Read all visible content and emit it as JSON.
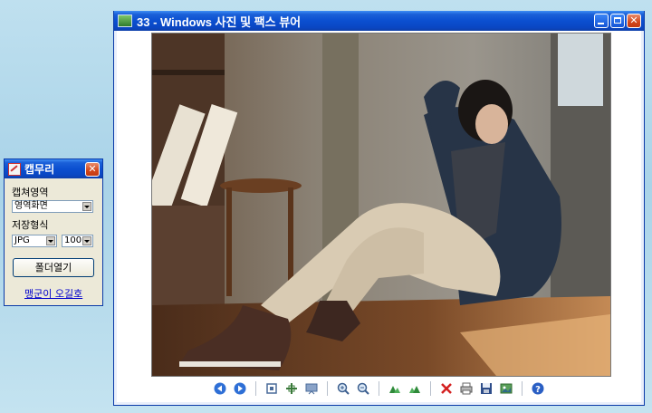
{
  "viewer": {
    "title": "33 - Windows 사진 및 팩스 뷰어",
    "image_description_name": "photo"
  },
  "capture": {
    "title": "캡무리",
    "area_label": "캡쳐영역",
    "area_value": "영역화면",
    "format_label": "저장형식",
    "format_value": "JPG",
    "quality_value": "100",
    "open_folder_button": "폴더열기",
    "link_text": "맹군이 오길호"
  },
  "toolbar": {
    "icons": [
      "prev-icon",
      "next-icon",
      "best-fit-icon",
      "actual-size-icon",
      "slideshow-icon",
      "zoom-in-icon",
      "zoom-out-icon",
      "rotate-cw-icon",
      "rotate-ccw-icon",
      "delete-icon",
      "print-icon",
      "save-icon",
      "edit-icon",
      "help-icon"
    ]
  },
  "colors": {
    "title_blue": "#0b4fd0",
    "close_red": "#d2461b"
  }
}
